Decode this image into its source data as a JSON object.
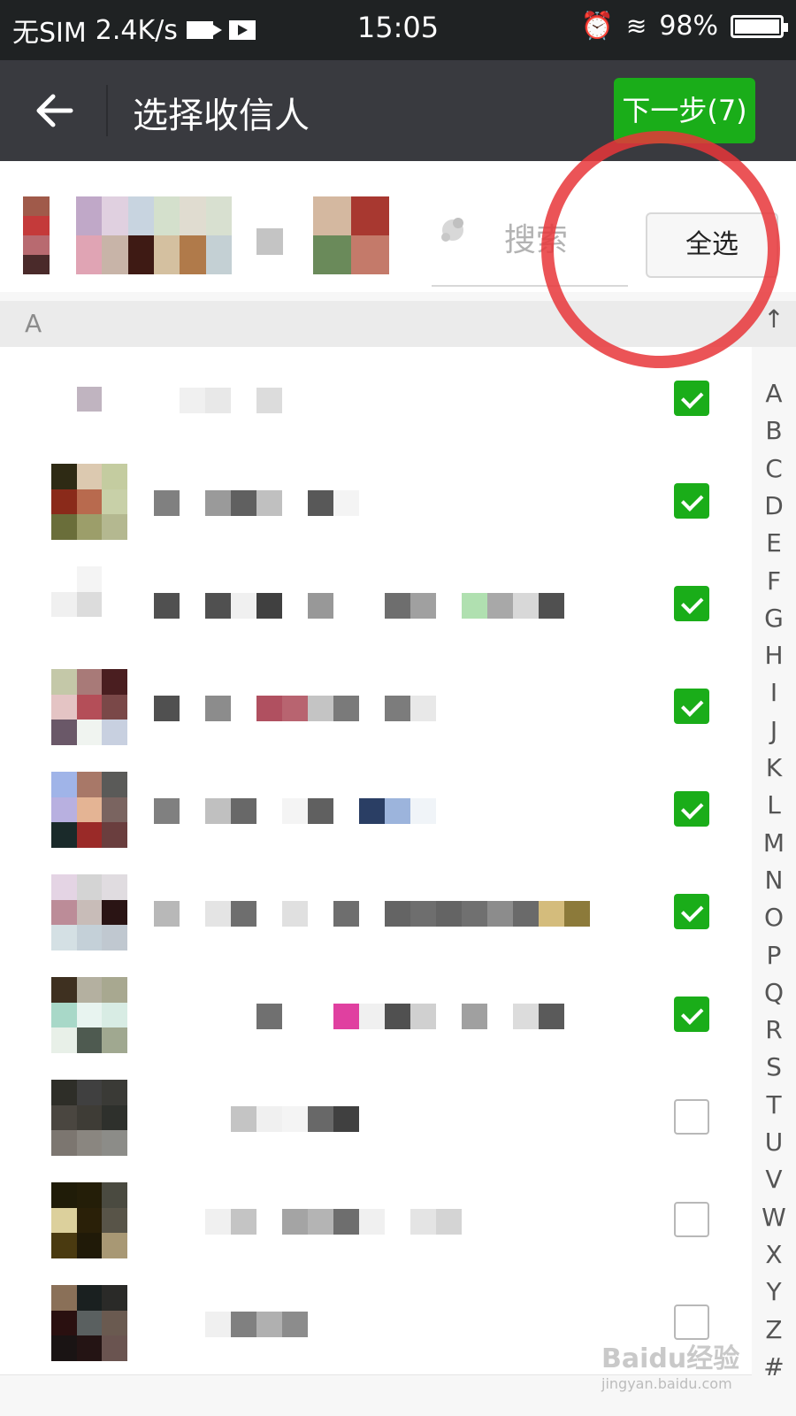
{
  "status_bar": {
    "carrier": "无SIM",
    "speed": "2.4K/s",
    "time": "15:05",
    "battery": "98%"
  },
  "nav": {
    "title": "选择收信人",
    "next_label": "下一步(7)"
  },
  "selection": {
    "search_placeholder": "搜索",
    "select_all_label": "全选"
  },
  "section_header": "A",
  "contacts": [
    {
      "checked": true,
      "avatar": [
        "#ffffff",
        "#ffffff",
        "#ffffff",
        "#ffffff",
        "#c0b4c0",
        "#ffffff",
        "#ffffff",
        "#ffffff",
        "#ffffff"
      ],
      "name": [
        "#ffffff",
        "#f0f0f0",
        "#e8e8e8",
        "#ffffff",
        "#dcdcdc",
        "#ffffff"
      ]
    },
    {
      "checked": true,
      "avatar": [
        "#2e2a14",
        "#dcc9b0",
        "#c4cca0",
        "#8a2a1a",
        "#b86a4e",
        "#c8d0a8",
        "#6a6e3a",
        "#9c9e6a",
        "#b4b890"
      ],
      "name": [
        "#808080",
        "#ffffff",
        "#9a9a9a",
        "#606060",
        "#c0c0c0",
        "#ffffff",
        "#585858",
        "#f4f4f4"
      ]
    },
    {
      "checked": true,
      "avatar": [
        "#ffffff",
        "#f4f4f4",
        "#ffffff",
        "#f0f0f0",
        "#dcdcdc",
        "#ffffff",
        "#ffffff",
        "#ffffff",
        "#ffffff"
      ],
      "name": [
        "#505050",
        "#ffffff",
        "#505050",
        "#f0f0f0",
        "#404040",
        "#ffffff",
        "#989898",
        "#ffffff",
        "#ffffff",
        "#6e6e6e",
        "#a0a0a0",
        "#ffffff",
        "#b0e0b0",
        "#a8a8a8",
        "#d8d8d8",
        "#505050"
      ]
    },
    {
      "checked": true,
      "avatar": [
        "#c4c8a8",
        "#a87a78",
        "#4a1e20",
        "#e4c4c4",
        "#b44e58",
        "#7a4848",
        "#6a5868",
        "#f0f4f0",
        "#c8d0e0"
      ],
      "name": [
        "#505050",
        "#ffffff",
        "#8c8c8c",
        "#ffffff",
        "#b05060",
        "#b86470",
        "#c4c4c4",
        "#7a7a7a",
        "#ffffff",
        "#7c7c7c",
        "#e8e8e8"
      ]
    },
    {
      "checked": true,
      "avatar": [
        "#a0b4e8",
        "#a87868",
        "#5a5a58",
        "#b8b0e0",
        "#e4b494",
        "#7a6460",
        "#1a2a2a",
        "#9a2a28",
        "#6a3e3e"
      ],
      "name": [
        "#808080",
        "#ffffff",
        "#c0c0c0",
        "#686868",
        "#ffffff",
        "#f4f4f4",
        "#606060",
        "#ffffff",
        "#2a3e64",
        "#9cb4dc",
        "#f0f4f8"
      ]
    },
    {
      "checked": true,
      "avatar": [
        "#e4d4e4",
        "#d4d4d4",
        "#e0dce0",
        "#bc8c98",
        "#c8bcb8",
        "#2a1414",
        "#d4e0e4",
        "#c4d0d8",
        "#c0c8d0"
      ],
      "name": [
        "#b8b8b8",
        "#ffffff",
        "#e4e4e4",
        "#6e6e6e",
        "#ffffff",
        "#e0e0e0",
        "#ffffff",
        "#6e6e6e",
        "#ffffff",
        "#646464",
        "#6e6e6e",
        "#646464",
        "#707070",
        "#8c8c8c",
        "#6a6a6a",
        "#d4bc7c",
        "#8c7a3a"
      ]
    },
    {
      "checked": true,
      "avatar": [
        "#3e3020",
        "#b4b0a0",
        "#a8a890",
        "#a8d8c8",
        "#e8f4f0",
        "#d8ece4",
        "#e8f0e8",
        "#4e5a50",
        "#a0a890"
      ],
      "name": [
        "#ffffff",
        "#ffffff",
        "#ffffff",
        "#ffffff",
        "#707070",
        "#ffffff",
        "#ffffff",
        "#e040a0",
        "#f0f0f0",
        "#505050",
        "#d0d0d0",
        "#ffffff",
        "#a0a0a0",
        "#ffffff",
        "#dcdcdc",
        "#5a5a5a"
      ]
    },
    {
      "checked": false,
      "avatar": [
        "#2e2e28",
        "#404040",
        "#3a3a36",
        "#4a4640",
        "#3e3c36",
        "#2e302c",
        "#7c7670",
        "#8a8680",
        "#8c8c88"
      ],
      "name": [
        "#ffffff",
        "#ffffff",
        "#ffffff",
        "#c4c4c4",
        "#f0f0f0",
        "#f4f4f4",
        "#686868",
        "#404040"
      ]
    },
    {
      "checked": false,
      "avatar": [
        "#201c08",
        "#241e08",
        "#4a4a40",
        "#dcd09c",
        "#2a2008",
        "#585448",
        "#4a3a10",
        "#201a08",
        "#a89874"
      ],
      "name": [
        "#ffffff",
        "#ffffff",
        "#f0f0f0",
        "#c4c4c4",
        "#ffffff",
        "#a4a4a4",
        "#b4b4b4",
        "#6e6e6e",
        "#f0f0f0",
        "#ffffff",
        "#e4e4e4",
        "#d4d4d4"
      ]
    },
    {
      "checked": false,
      "avatar": [
        "#8a7058",
        "#1a2020",
        "#2a2a28",
        "#2a1010",
        "#5a6060",
        "#6a5a50",
        "#1a1414",
        "#241414",
        "#6a5450"
      ],
      "name": [
        "#ffffff",
        "#ffffff",
        "#f0f0f0",
        "#808080",
        "#b0b0b0",
        "#8c8c8c"
      ]
    }
  ],
  "index_letters": [
    "A",
    "B",
    "C",
    "D",
    "E",
    "F",
    "G",
    "H",
    "I",
    "J",
    "K",
    "L",
    "M",
    "N",
    "O",
    "P",
    "Q",
    "R",
    "S",
    "T",
    "U",
    "V",
    "W",
    "X",
    "Y",
    "Z",
    "#"
  ],
  "selected_avatars": [
    {
      "colors": [
        "#a05a4a",
        "#c43a3a",
        "#b86a70",
        "#4a2a2a"
      ]
    },
    {
      "colors": [
        "#c0a8c8",
        "#e0d0e0",
        "#c8d4e0",
        "#d4e0cc",
        "#e0a4b4",
        "#c8b4a8",
        "#3e1a14",
        "#b07a4a",
        "#c4d0d4",
        "#d4dce0",
        "#121212",
        "#4a4a2a"
      ]
    },
    {
      "colors": [
        "#a83830",
        "#d86060",
        "#6a8a5a",
        "#c47a6a"
      ]
    }
  ],
  "watermark": {
    "logo": "Baidu经验",
    "url": "jingyan.baidu.com"
  },
  "colors": {
    "accent_green": "#1aad19",
    "nav_bg": "#393a3f",
    "annotation_red": "#e8363a"
  }
}
